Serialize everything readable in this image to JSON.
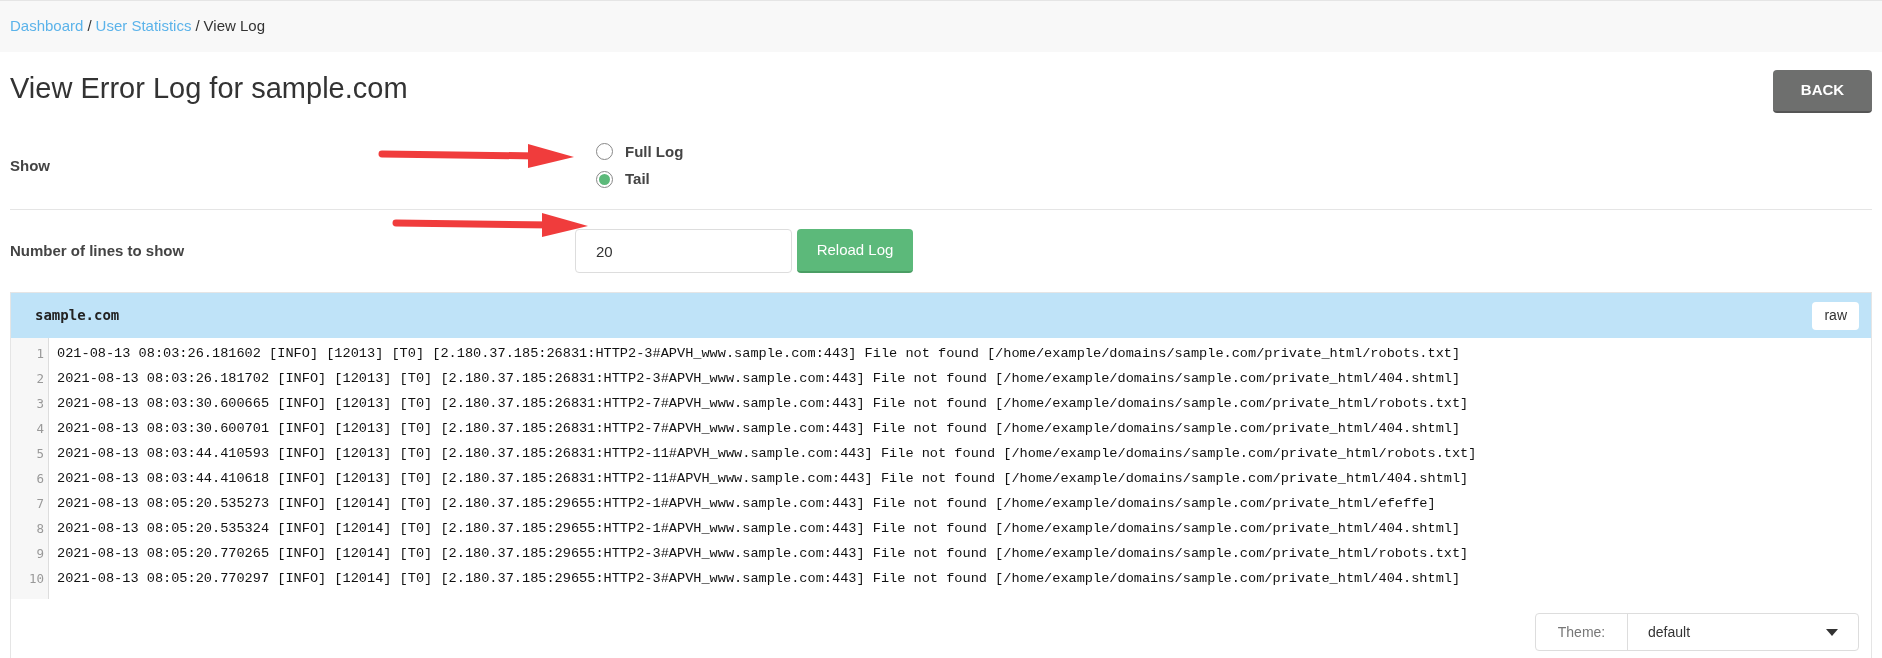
{
  "breadcrumb": [
    {
      "label": "Dashboard",
      "kind": "link"
    },
    {
      "label": "User Statistics",
      "kind": "link"
    },
    {
      "label": "View Log",
      "kind": "current"
    }
  ],
  "breadcrumb_separator": "/",
  "title": "View Error Log for sample.com",
  "back_button": "BACK",
  "show": {
    "label": "Show",
    "options": [
      {
        "label": "Full Log",
        "selected": false
      },
      {
        "label": "Tail",
        "selected": true
      }
    ]
  },
  "lines_field": {
    "label": "Number of lines to show",
    "value": "20",
    "button": "Reload Log"
  },
  "log": {
    "title": "sample.com",
    "raw_button": "raw",
    "lines": [
      {
        "number": "1",
        "text": "021-08-13 08:03:26.181602 [INFO] [12013] [T0] [2.180.37.185:26831:HTTP2-3#APVH_www.sample.com:443] File not found [/home/example/domains/sample.com/private_html/robots.txt]"
      },
      {
        "number": "2",
        "text": "2021-08-13 08:03:26.181702 [INFO] [12013] [T0] [2.180.37.185:26831:HTTP2-3#APVH_www.sample.com:443] File not found [/home/example/domains/sample.com/private_html/404.shtml]"
      },
      {
        "number": "3",
        "text": "2021-08-13 08:03:30.600665 [INFO] [12013] [T0] [2.180.37.185:26831:HTTP2-7#APVH_www.sample.com:443] File not found [/home/example/domains/sample.com/private_html/robots.txt]"
      },
      {
        "number": "4",
        "text": "2021-08-13 08:03:30.600701 [INFO] [12013] [T0] [2.180.37.185:26831:HTTP2-7#APVH_www.sample.com:443] File not found [/home/example/domains/sample.com/private_html/404.shtml]"
      },
      {
        "number": "5",
        "text": "2021-08-13 08:03:44.410593 [INFO] [12013] [T0] [2.180.37.185:26831:HTTP2-11#APVH_www.sample.com:443] File not found [/home/example/domains/sample.com/private_html/robots.txt]"
      },
      {
        "number": "6",
        "text": "2021-08-13 08:03:44.410618 [INFO] [12013] [T0] [2.180.37.185:26831:HTTP2-11#APVH_www.sample.com:443] File not found [/home/example/domains/sample.com/private_html/404.shtml]"
      },
      {
        "number": "7",
        "text": "2021-08-13 08:05:20.535273 [INFO] [12014] [T0] [2.180.37.185:29655:HTTP2-1#APVH_www.sample.com:443] File not found [/home/example/domains/sample.com/private_html/efeffe]"
      },
      {
        "number": "8",
        "text": "2021-08-13 08:05:20.535324 [INFO] [12014] [T0] [2.180.37.185:29655:HTTP2-1#APVH_www.sample.com:443] File not found [/home/example/domains/sample.com/private_html/404.shtml]"
      },
      {
        "number": "9",
        "text": "2021-08-13 08:05:20.770265 [INFO] [12014] [T0] [2.180.37.185:29655:HTTP2-3#APVH_www.sample.com:443] File not found [/home/example/domains/sample.com/private_html/robots.txt]"
      },
      {
        "number": "10",
        "text": "2021-08-13 08:05:20.770297 [INFO] [12014] [T0] [2.180.37.185:29655:HTTP2-3#APVH_www.sample.com:443] File not found [/home/example/domains/sample.com/private_html/404.shtml]"
      }
    ]
  },
  "theme": {
    "label": "Theme:",
    "value": "default"
  }
}
